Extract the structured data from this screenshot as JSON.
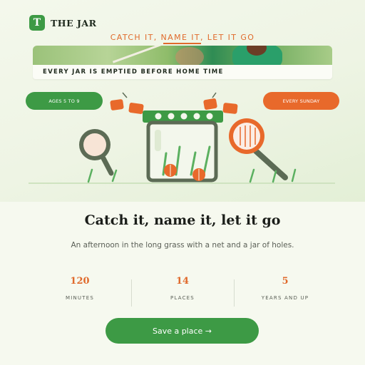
{
  "brand": {
    "logo_letter": "T",
    "name": "THE JAR"
  },
  "kicker": {
    "text": "CATCH IT, NAME IT, LET IT GO"
  },
  "banner": {
    "text": "EVERY JAR IS EMPTIED BEFORE HOME TIME"
  },
  "pills": {
    "ages": "AGES 5 TO 9",
    "day": "EVERY SUNDAY"
  },
  "main": {
    "heading": "Catch it, name it, let it go",
    "subtitle": "An afternoon in the long grass with a net and a jar of holes."
  },
  "stats": [
    {
      "value": "120",
      "label": "MINUTES"
    },
    {
      "value": "14",
      "label": "PLACES"
    },
    {
      "value": "5",
      "label": "YEARS AND UP"
    }
  ],
  "cta": {
    "label": "Save a place →"
  },
  "colors": {
    "green": "#3d9a45",
    "orange": "#e8692b",
    "background": "#f6f9ef",
    "dark": "#1b1e1a"
  }
}
